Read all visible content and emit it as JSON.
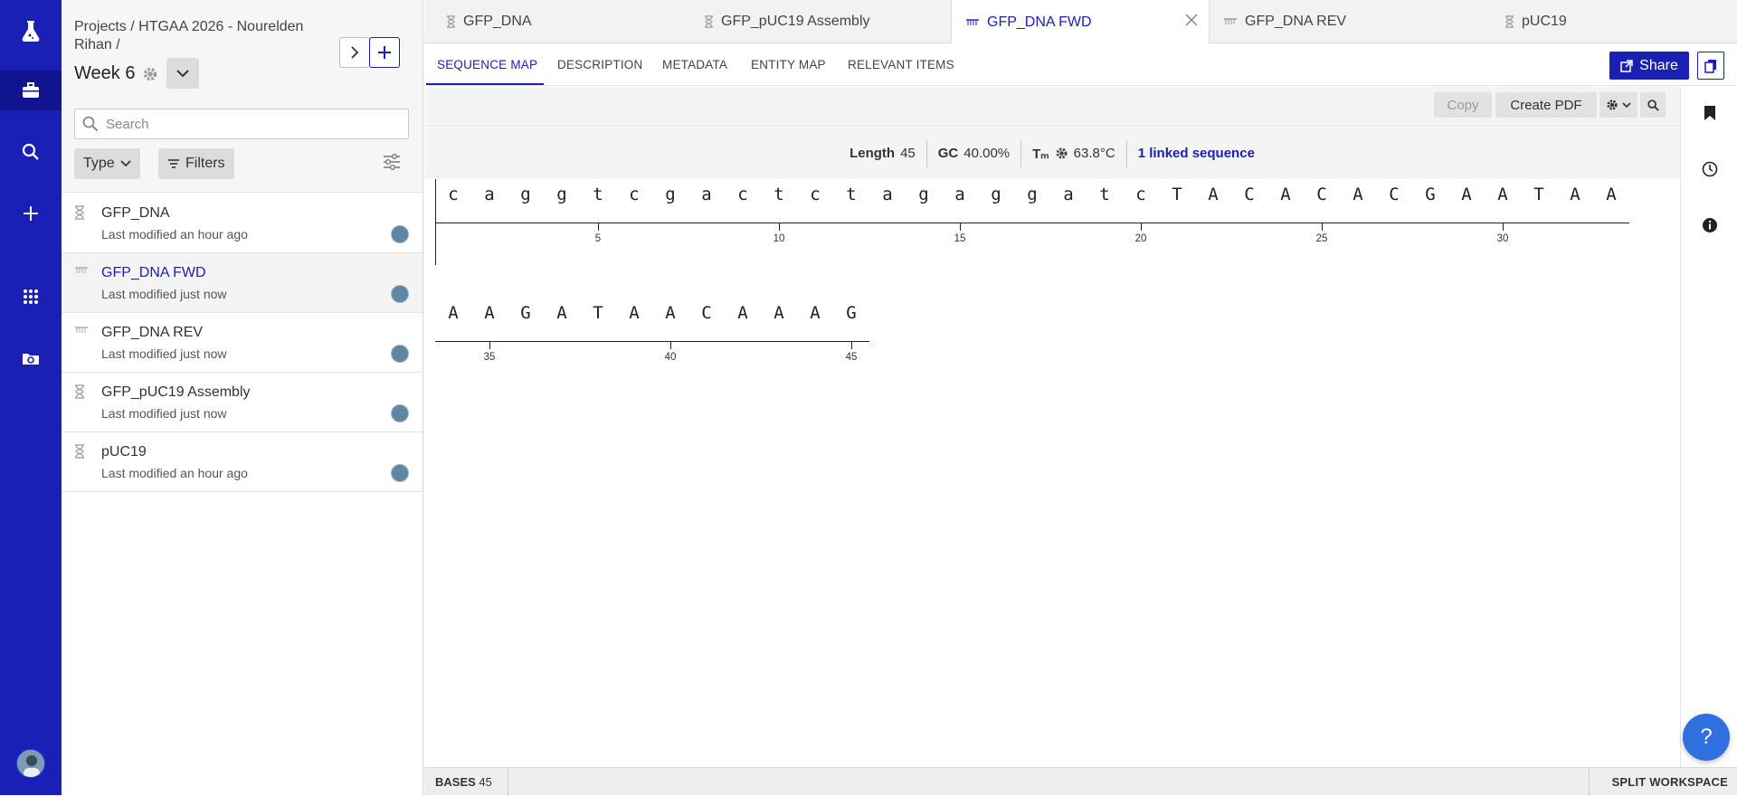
{
  "rail": {
    "icons": [
      "flask-logo-icon",
      "briefcase-icon",
      "search-icon",
      "plus-icon",
      "apps-grid-icon",
      "folder-sync-icon"
    ],
    "avatar": "user-avatar"
  },
  "sidebar": {
    "breadcrumb": "Projects / HTGAA 2026 - Nourelden Rihan /",
    "workspace_title": "Week 6",
    "search_placeholder": "Search",
    "type_label": "Type",
    "filters_label": "Filters",
    "items": [
      {
        "name": "GFP_DNA",
        "modified": "Last modified an hour ago",
        "icon": "hourglass-icon"
      },
      {
        "name": "GFP_DNA FWD",
        "modified": "Last modified just now",
        "icon": "oligo-icon"
      },
      {
        "name": "GFP_DNA REV",
        "modified": "Last modified just now",
        "icon": "oligo-icon"
      },
      {
        "name": "GFP_pUC19 Assembly",
        "modified": "Last modified just now",
        "icon": "hourglass-icon"
      },
      {
        "name": "pUC19",
        "modified": "Last modified an hour ago",
        "icon": "hourglass-icon"
      }
    ]
  },
  "tabs": [
    {
      "label": "GFP_DNA"
    },
    {
      "label": "GFP_pUC19 Assembly"
    },
    {
      "label": "GFP_DNA FWD"
    },
    {
      "label": "GFP_DNA REV"
    },
    {
      "label": "pUC19"
    }
  ],
  "subnav": [
    "SEQUENCE MAP",
    "DESCRIPTION",
    "METADATA",
    "ENTITY MAP",
    "RELEVANT ITEMS"
  ],
  "share_label": "Share",
  "toolbar": {
    "copy": "Copy",
    "create_pdf": "Create PDF"
  },
  "stats": {
    "length_label": "Length",
    "length_value": "45",
    "gc_label": "GC",
    "gc_value": "40.00%",
    "tm_label": "Tₘ",
    "tm_value": "63.8°C",
    "linked": "1 linked sequence"
  },
  "sequence": {
    "row1": "caggtcgactctagaggatcTACACACGAATAA",
    "row2": "AAGATAACAAAG",
    "ticks_row1": [
      "5",
      "10",
      "15",
      "20",
      "25",
      "30"
    ],
    "ticks_row2": [
      "35",
      "40",
      "45"
    ]
  },
  "status": {
    "bases_label": "BASES",
    "bases_value": "45",
    "split": "SPLIT WORKSPACE"
  },
  "help": "?"
}
